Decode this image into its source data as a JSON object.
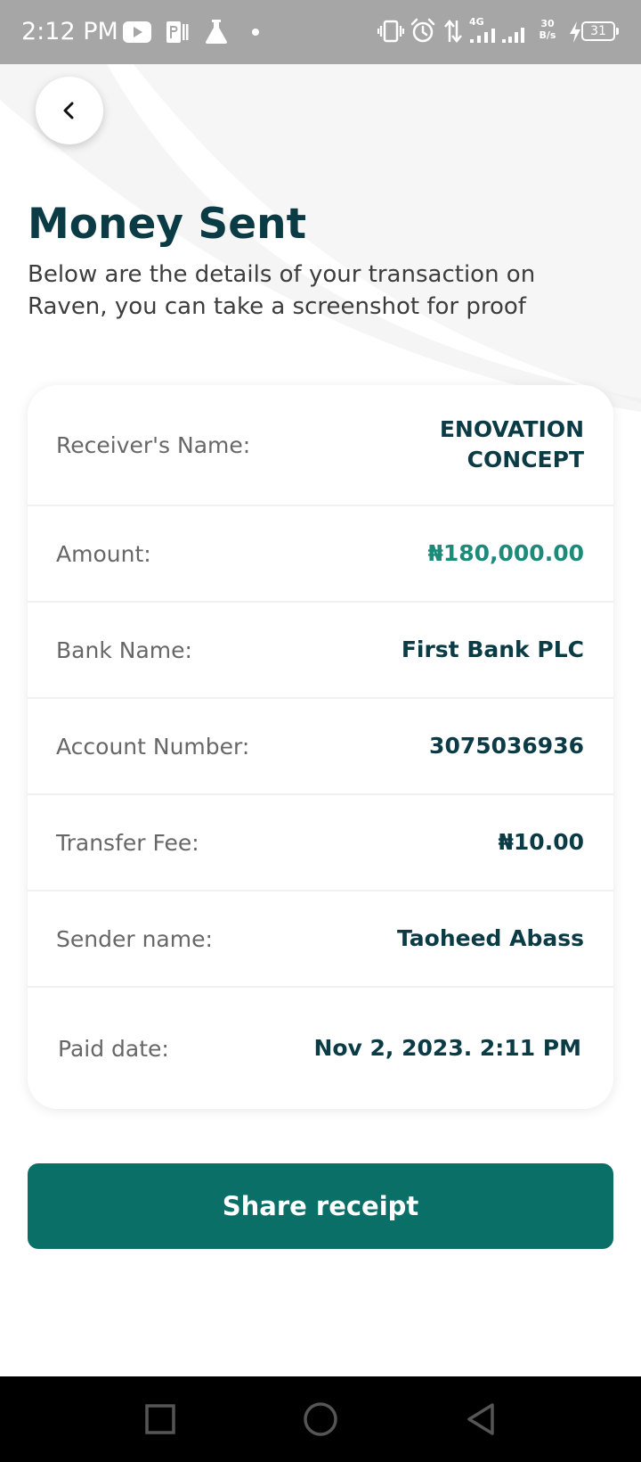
{
  "status_bar": {
    "time": "2:12 PM",
    "network_type": "4G",
    "speed_value": "30",
    "speed_unit": "B/s",
    "battery": "31",
    "icons": [
      "youtube-icon",
      "parking-icon",
      "flask-icon",
      "dot-icon",
      "vibrate-icon",
      "alarm-icon",
      "data-transfer-icon",
      "signal-icon",
      "signal-icon",
      "speed-indicator",
      "charging-icon",
      "battery-icon"
    ]
  },
  "header": {
    "back_icon": "chevron-left-icon",
    "title": "Money Sent",
    "subtitle": "Below are the details of your transaction on Raven, you can take a screenshot for proof"
  },
  "details": [
    {
      "label": "Receiver's Name:",
      "value": "ENOVATION CONCEPT"
    },
    {
      "label": "Amount:",
      "value": "₦180,000.00"
    },
    {
      "label": "Bank Name:",
      "value": "First Bank PLC"
    },
    {
      "label": "Account Number:",
      "value": "3075036936"
    },
    {
      "label": "Transfer Fee:",
      "value": "₦10.00"
    },
    {
      "label": "Sender name:",
      "value": "Taoheed Abass"
    },
    {
      "label": "Paid date:",
      "value": "Nov 2, 2023. 2:11 PM"
    }
  ],
  "actions": {
    "share_label": "Share receipt"
  },
  "nav": {
    "icons": [
      "recent-apps-icon",
      "home-icon",
      "back-icon"
    ]
  },
  "colors": {
    "primary": "#0a6f66",
    "title": "#0b3b45",
    "amount": "#1d8a7a",
    "status_bar": "#a6a6a6"
  }
}
